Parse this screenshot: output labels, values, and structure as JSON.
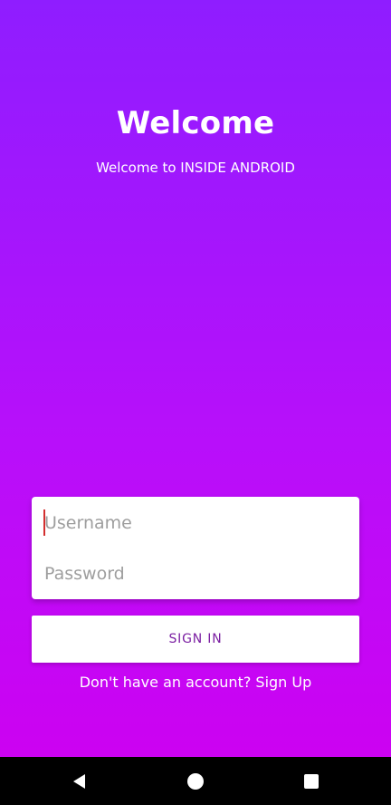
{
  "header": {
    "title": "Welcome",
    "subtitle": "Welcome to INSIDE ANDROID"
  },
  "login_form": {
    "username_placeholder": "Username",
    "password_placeholder": "Password",
    "username_value": "",
    "password_value": ""
  },
  "actions": {
    "sign_in_label": "SIGN IN",
    "sign_up_prompt": "Don't have an account? Sign Up"
  },
  "nav_bar": {
    "back_icon": "back-triangle-icon",
    "home_icon": "home-circle-icon",
    "recents_icon": "recents-square-icon"
  },
  "colors": {
    "gradient_top": "#8f1dff",
    "gradient_bottom": "#cf00f0",
    "button_text": "#7b1fa2",
    "cursor": "#d32f2f"
  }
}
